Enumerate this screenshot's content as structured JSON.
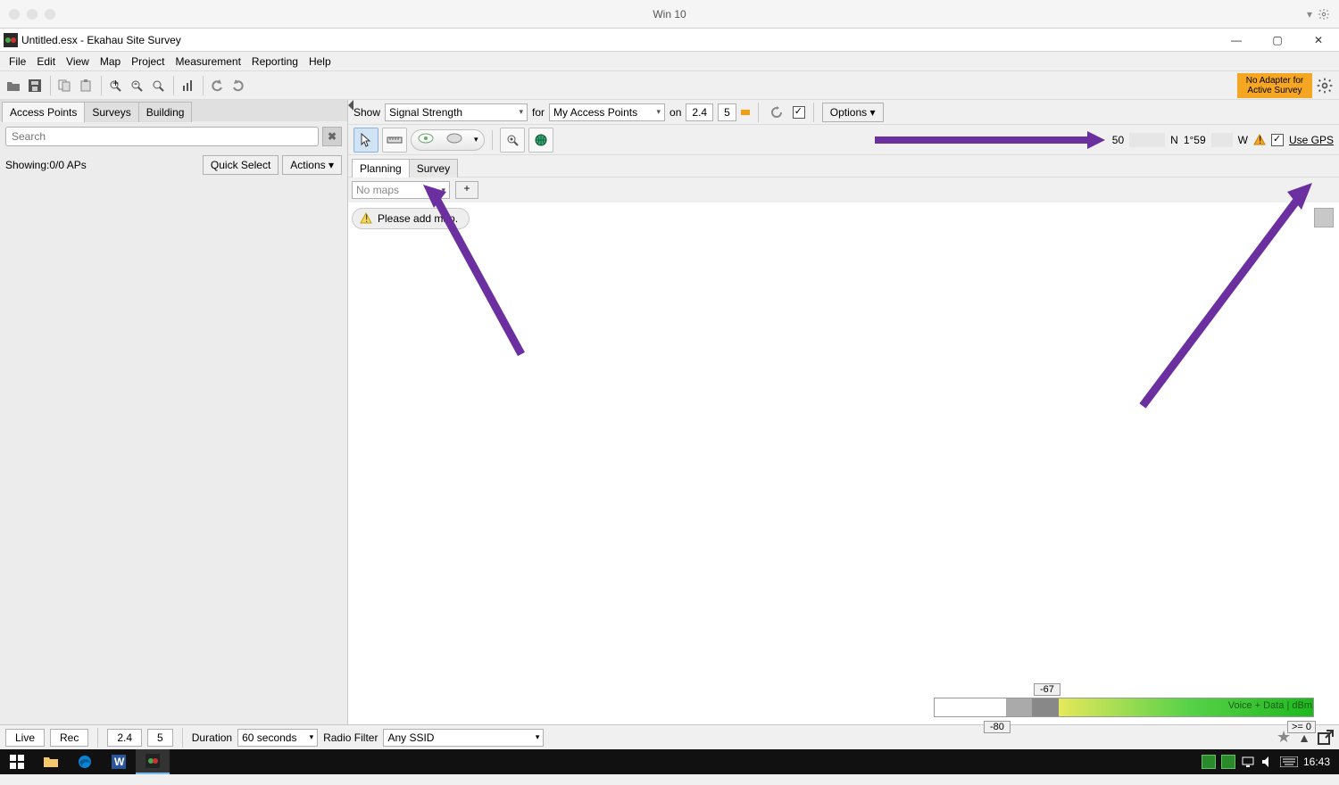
{
  "outer": {
    "title": "Win 10"
  },
  "app": {
    "title": "Untitled.esx - Ekahau Site Survey"
  },
  "menu": [
    "File",
    "Edit",
    "View",
    "Map",
    "Project",
    "Measurement",
    "Reporting",
    "Help"
  ],
  "toolbar": {
    "no_adapter": "No Adapter for Active Survey"
  },
  "sidebar": {
    "tabs": [
      "Access Points",
      "Surveys",
      "Building"
    ],
    "search_placeholder": "Search",
    "showing": "Showing:0/0 APs",
    "quick_select": "Quick Select",
    "actions": "Actions ▾"
  },
  "filter": {
    "show": "Show",
    "show_value": "Signal Strength",
    "for": "for",
    "for_value": "My Access Points",
    "on": "on",
    "band24": "2.4",
    "band5": "5",
    "options": "Options ▾"
  },
  "gps": {
    "lat_val": "50",
    "lat_dir": "N",
    "lon_val": "1°59",
    "lon_dir": "W",
    "use_gps": "Use GPS"
  },
  "subtabs": {
    "planning": "Planning",
    "survey": "Survey"
  },
  "map": {
    "selector": "No maps",
    "add": "+",
    "hint": "Please add map."
  },
  "legend": {
    "marker_top": "-67",
    "marker_bottom": "-80",
    "caption": "Voice + Data | dBm",
    "max": ">= 0"
  },
  "bottom": {
    "live": "Live",
    "rec": "Rec",
    "b24": "2.4",
    "b5": "5",
    "duration_label": "Duration",
    "duration_value": "60 seconds",
    "radio_label": "Radio Filter",
    "radio_value": "Any SSID"
  },
  "taskbar": {
    "clock": "16:43"
  }
}
